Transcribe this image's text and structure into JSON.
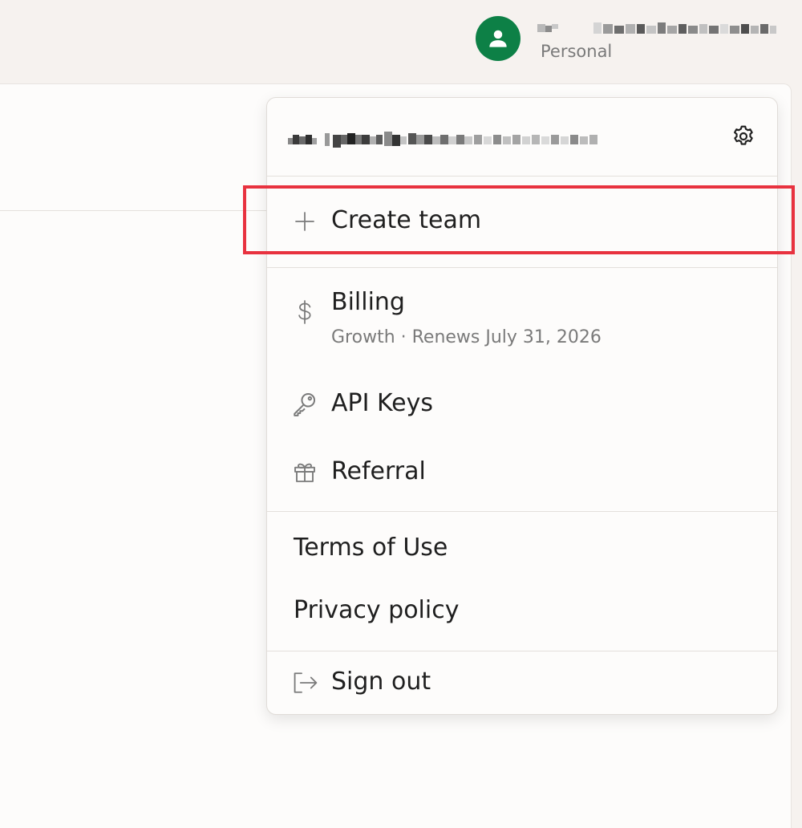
{
  "header": {
    "user_name_redacted": "redacted-user-name",
    "plan_label": "Personal",
    "avatar_color": "#0d8046"
  },
  "menu": {
    "email_redacted": "redacted-email",
    "settings_icon": "gear-icon",
    "create_team": {
      "label": "Create team",
      "icon": "plus-icon"
    },
    "billing": {
      "label": "Billing",
      "sub": "Growth · Renews July 31, 2026",
      "icon": "dollar-icon"
    },
    "api_keys": {
      "label": "API Keys",
      "icon": "key-icon"
    },
    "referral": {
      "label": "Referral",
      "icon": "gift-icon"
    },
    "terms": {
      "label": "Terms of Use"
    },
    "privacy": {
      "label": "Privacy policy"
    },
    "sign_out": {
      "label": "Sign out",
      "icon": "sign-out-icon"
    }
  },
  "annotation": {
    "highlight_color": "#e8323f"
  }
}
